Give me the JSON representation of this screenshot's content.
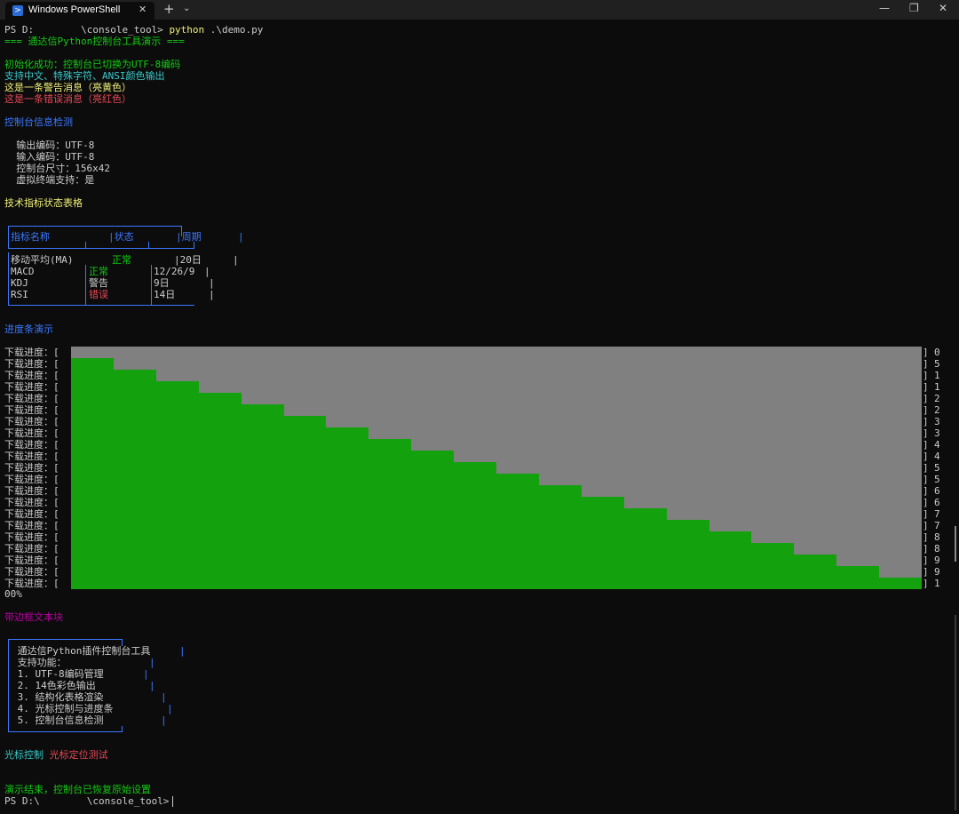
{
  "window": {
    "tab_title": "Windows PowerShell",
    "tab_close": "✕",
    "new_tab": "+",
    "dropdown": "⌄",
    "minimize": "—",
    "maximize": "❐",
    "close": "✕"
  },
  "terminal": {
    "prompt1": "PS D:        \\console_tool> ",
    "cmd_python": "python",
    "cmd_args": " .\\demo.py",
    "banner": "=== 通达信Python控制台工具演示 ===",
    "init_ok": "初始化成功：控制台已切换为UTF-8编码",
    "support_line": "支持中文、特殊字符、ANSI颜色输出",
    "warning_line": "这是一条警告消息（亮黄色）",
    "error_line": "这是一条错误消息（亮红色）",
    "info_heading": "控制台信息检测",
    "info_lines": [
      "  输出编码：UTF-8",
      "  输入编码：UTF-8",
      "  控制台尺寸：156x42",
      "  虚拟终端支持：是"
    ],
    "table_heading": "技术指标状态表格",
    "table": {
      "headers": [
        "指标名称",
        "|状态",
        "|周期"
      ],
      "header_end": "|",
      "rows": [
        {
          "name": "移动平均(MA)",
          "status": "正常",
          "period": "|20日",
          "end": "|"
        },
        {
          "name": "MACD",
          "status": "正常",
          "period": "12/26/9",
          "end": "|"
        },
        {
          "name": "KDJ",
          "status": "警告",
          "period": "9日",
          "end": "|"
        },
        {
          "name": "RSI",
          "status": "错误",
          "period": "14日",
          "end": "|"
        }
      ]
    },
    "progress_heading": "进度条演示",
    "progress_label": "下载进度：[",
    "progress_close": "]",
    "progress_fractions": [
      0,
      0.05,
      0.1,
      0.15,
      0.2,
      0.25,
      0.3,
      0.35,
      0.4,
      0.45,
      0.5,
      0.55,
      0.6,
      0.65,
      0.7,
      0.75,
      0.8,
      0.85,
      0.9,
      0.95,
      1.0
    ],
    "progress_tail": [
      "0",
      "5",
      "1",
      "1",
      "2",
      "2",
      "3",
      "3",
      "4",
      "4",
      "5",
      "5",
      "6",
      "6",
      "7",
      "7",
      "8",
      "8",
      "9",
      "9",
      "1"
    ],
    "progress_end": "00%",
    "bordered_heading": "带边框文本块",
    "bordered_lines": [
      {
        "text": " 通达信Python插件控制台工具 ",
        "end": "|"
      },
      {
        "text": " 支持功能：",
        "end": "|"
      },
      {
        "text": " 1. UTF-8编码管理",
        "end": "|"
      },
      {
        "text": " 2. 14色彩色输出",
        "end": "|"
      },
      {
        "text": " 3. 结构化表格渲染",
        "end": "|"
      },
      {
        "text": " 4. 光标控制与进度条",
        "end": "|"
      },
      {
        "text": " 5. 控制台信息检测",
        "end": "|"
      }
    ],
    "cursor_label": "光标控制",
    "cursor_test": "光标定位测试",
    "end_msg": "演示结束，控制台已恢复原始设置",
    "prompt2": "PS D:\\        \\console_tool> "
  },
  "colors": {
    "background": "#0c0c0c",
    "progress_fill": "#13a10e",
    "progress_empty": "#808080",
    "border": "#3b78ff"
  }
}
